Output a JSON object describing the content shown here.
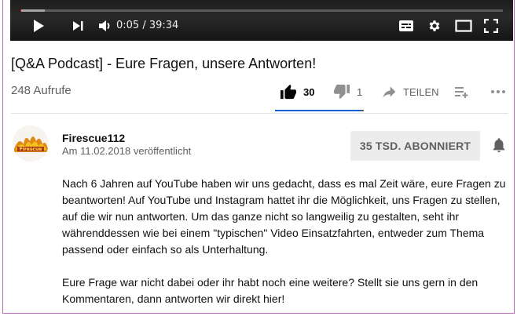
{
  "player": {
    "time_display": "0:05 / 39:34",
    "progress_fraction": 0.0021,
    "buffer_fraction": 0.05,
    "icons": [
      "play-icon",
      "next-icon",
      "volume-icon",
      "subtitles-icon",
      "settings-icon",
      "theater-mode-icon",
      "fullscreen-icon"
    ]
  },
  "video": {
    "title": "[Q&A Podcast] - Eure Fragen, unsere Antworten!",
    "views": "248 Aufrufe"
  },
  "actions": {
    "likes": "30",
    "dislikes": "1",
    "share_label": "TEILEN",
    "like_ratio": 0.968
  },
  "channel": {
    "name": "Firescue112",
    "published": "Am 11.02.2018 veröffentlicht",
    "subscribe_label": "35 TSD. ABONNIERT"
  },
  "description": {
    "paragraph_1": "Nach 6 Jahren auf YouTube haben wir uns gedacht, dass es mal Zeit wäre, eure Fragen zu beantworten! Auf YouTube und Instagram hattet ihr die Möglichkeit, uns Fragen zu stellen, auf die wir nun antworten. Um das ganze nicht so langweilig zu gestalten, seht ihr währenddessen wie bei einem \"typischen\" Video Einsatzfahrten, entweder zum Thema passend oder einfach so als Unterhaltung.",
    "paragraph_2": "Eure Frage war nicht dabei oder ihr habt noch eine weitere? Stellt sie uns gern in den Kommentaren, dann antworten wir direkt hier!"
  },
  "colors": {
    "accent_blue": "#065fd4",
    "progress_red": "#ff0000",
    "player_bg": "#121212"
  }
}
